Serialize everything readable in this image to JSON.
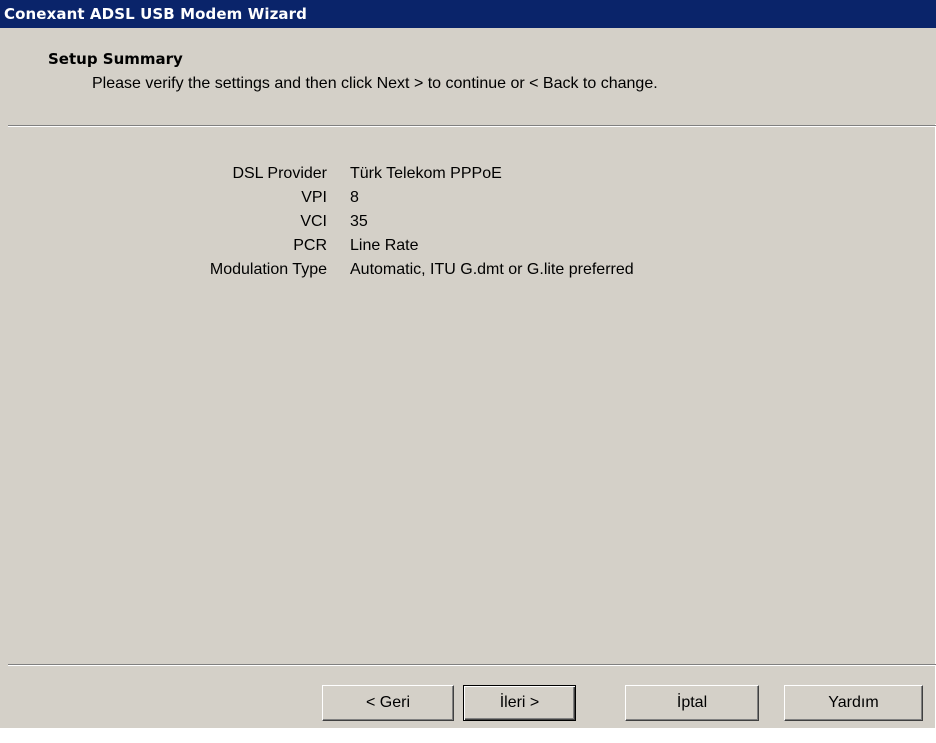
{
  "window": {
    "title": "Conexant ADSL USB Modem Wizard"
  },
  "header": {
    "title": "Setup Summary",
    "subtitle": "Please verify the settings and then click Next > to continue or < Back to change."
  },
  "summary": [
    {
      "label": "DSL Provider",
      "value": "Türk Telekom PPPoE"
    },
    {
      "label": "VPI",
      "value": "8"
    },
    {
      "label": "VCI",
      "value": "35"
    },
    {
      "label": "PCR",
      "value": "Line Rate"
    },
    {
      "label": "Modulation Type",
      "value": "Automatic, ITU G.dmt or G.lite preferred"
    }
  ],
  "buttons": {
    "back_label": "< Geri",
    "next_label": "İleri >",
    "cancel_label": "İptal",
    "help_label": "Yardım"
  },
  "colors": {
    "titlebar": "#0a246a",
    "face": "#d4d0c8"
  }
}
